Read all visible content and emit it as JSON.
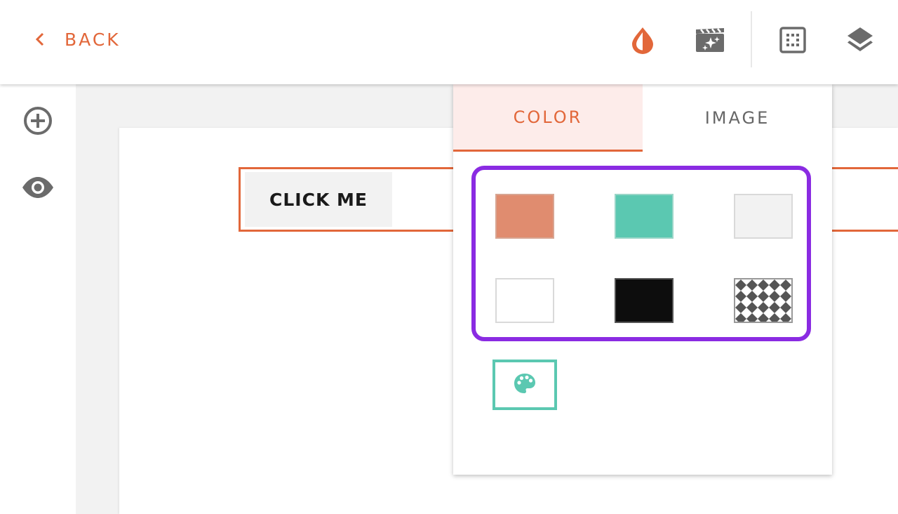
{
  "header": {
    "back_label": "BACK",
    "icons": [
      "water-drop-icon",
      "magic-movie-icon",
      "grid-icon",
      "layers-icon"
    ]
  },
  "sidebar": {
    "icons": [
      "add-circle-icon",
      "eye-icon"
    ]
  },
  "canvas": {
    "button_label": "CLICK ME"
  },
  "background_panel": {
    "tabs": [
      {
        "label": "COLOR",
        "active": true
      },
      {
        "label": "IMAGE",
        "active": false
      }
    ],
    "swatches": [
      {
        "name": "salmon",
        "color": "#e08c6f"
      },
      {
        "name": "teal",
        "color": "#5bc8b1"
      },
      {
        "name": "light-gray",
        "color": "#f2f2f2"
      },
      {
        "name": "white",
        "color": "#ffffff"
      },
      {
        "name": "black",
        "color": "#0d0d0d"
      },
      {
        "name": "transparent",
        "color": "checkerboard"
      }
    ],
    "custom_picker_icon": "palette-icon"
  },
  "colors": {
    "accent": "#e2673a",
    "highlight": "#8a2be2",
    "teal": "#5bc8b1",
    "icon_gray": "#6b6b6b"
  }
}
